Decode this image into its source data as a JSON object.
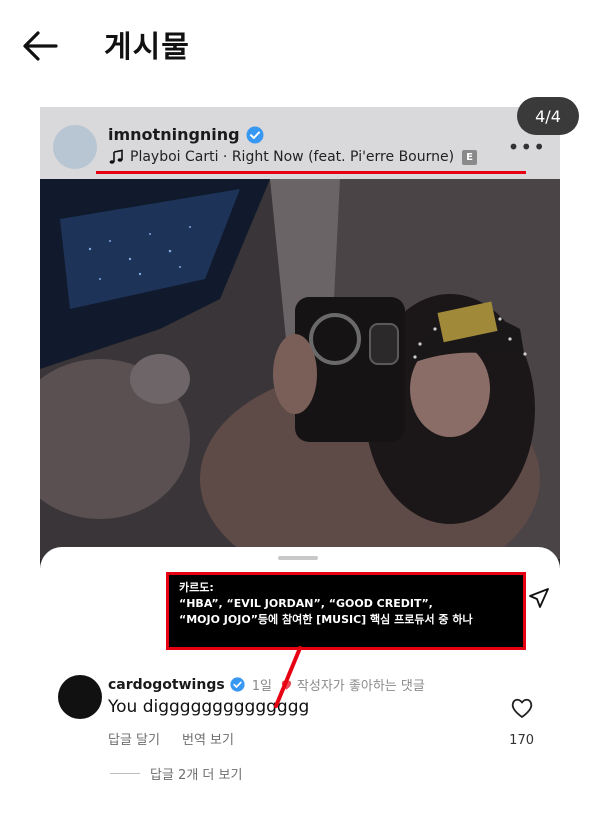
{
  "header": {
    "title": "게시물",
    "back_icon": "arrow-left-icon"
  },
  "post": {
    "username": "imnotningning",
    "music": "Playboi Carti · Right Now (feat. Pi'erre Bourne)",
    "explicit_badge": "E",
    "more_icon": "•••",
    "counter": "4/4"
  },
  "comment": {
    "username": "cardogotwings",
    "time": "1일",
    "liked_by_author": "작성자가 좋아하는 댓글",
    "text": "You digggggggggggggg",
    "reply": "답글 달기",
    "translate": "번역 보기",
    "like_count": "170",
    "more_replies": "답글 2개 더 보기"
  },
  "annotation": {
    "line1": "카르도:",
    "line2": "“HBA”, “EVIL JORDAN”, “GOOD CREDIT”,",
    "line3": "“MOJO JOJO”등에 참여한 [MUSIC] 핵심 프로듀서 중 하나"
  },
  "colors": {
    "accent_red": "#e60012",
    "verified_blue": "#3897f0",
    "heart_red": "#ed4956"
  }
}
